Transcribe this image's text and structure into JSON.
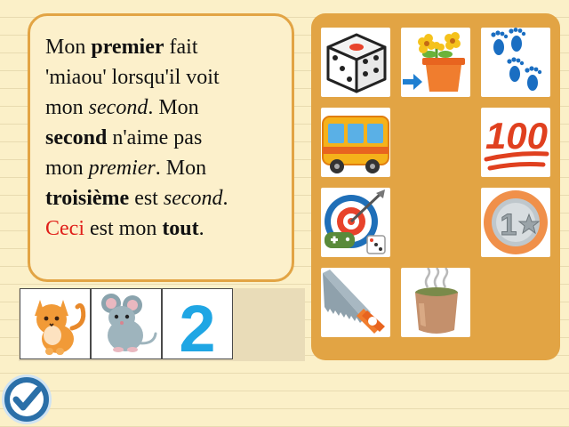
{
  "riddle": {
    "l1_a": "Mon ",
    "l1_b": "premier",
    "l1_c": " fait",
    "l2": "'miaou' lorsqu'il voit",
    "l3_a": "mon ",
    "l3_b": "second",
    "l3_c": ". Mon",
    "l4_a": "second",
    "l4_b": " n'aime pas",
    "l5_a": "mon ",
    "l5_b": "premier",
    "l5_c": ". Mon",
    "l6_a": "troisième",
    "l6_b": " est ",
    "l6_c": "second",
    "l6_d": ".",
    "l7_a": "Ceci",
    "l7_b": " est mon ",
    "l7_c": "tout",
    "l7_d": "."
  },
  "answer_slots": [
    {
      "icon": "cat-icon"
    },
    {
      "icon": "mouse-icon"
    },
    {
      "icon": "number-two-icon",
      "text": "2"
    }
  ],
  "tiles": [
    {
      "icon": "dice-icon"
    },
    {
      "icon": "flower-pot-icon"
    },
    {
      "icon": "footprints-icon"
    },
    {
      "icon": "bus-icon"
    },
    {
      "icon": "hundred-points-icon",
      "text": "100"
    },
    {
      "icon": "video-game-target-icon"
    },
    {
      "icon": "first-place-medal-icon",
      "text": "1"
    },
    {
      "icon": "saw-icon"
    },
    {
      "icon": "tea-cup-icon"
    }
  ],
  "colors": {
    "background": "#fbf0c8",
    "panel": "#e2a444",
    "highlight": "#e0201a",
    "button": "#2a6fa8"
  }
}
